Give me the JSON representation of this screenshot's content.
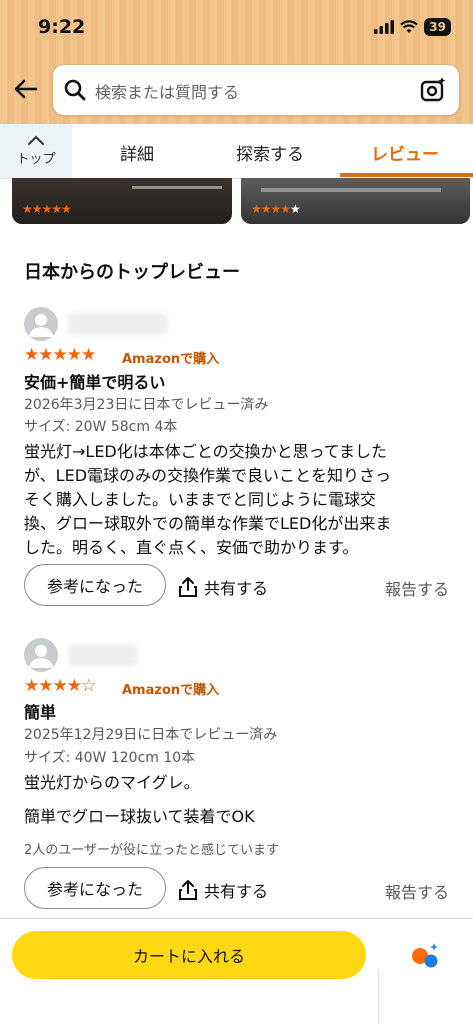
{
  "status": {
    "time": "9:22",
    "battery": "39"
  },
  "search": {
    "placeholder": "検索または質問する"
  },
  "tabs": {
    "top_label": "トップ",
    "items": [
      {
        "label": "詳細"
      },
      {
        "label": "探索する"
      },
      {
        "label": "レビュー"
      }
    ]
  },
  "section_title": "日本からのトップレビュー",
  "reviews": [
    {
      "rating": 5,
      "verified": "Amazonで購入",
      "title": "安価+簡単で明るい",
      "date": "2026年3月23日に日本でレビュー済み",
      "variant": "サイズ: 20W 58cm 4本",
      "body": [
        "蛍光灯→LED化は本体ごとの交換かと思ってました",
        "が、LED電球のみの交換作業で良いことを知りさっ",
        "そく購入しました。いままでと同じように電球交",
        "換、グロー球取外での簡単な作業でLED化が出来ま",
        "した。明るく、直ぐ点く、安価で助かります。"
      ],
      "helpful_label": "参考になった",
      "share_label": "共有する",
      "report_label": "報告する"
    },
    {
      "rating": 4,
      "verified": "Amazonで購入",
      "title": "簡単",
      "date": "2025年12月29日に日本でレビュー済み",
      "variant": "サイズ: 40W 120cm 10本",
      "body": [
        "蛍光灯からのマイグレ。",
        "簡単でグロー球抜いて装着でOK"
      ],
      "helpful_note": "2人のユーザーが役に立ったと感じています",
      "helpful_label": "参考になった",
      "share_label": "共有する",
      "report_label": "報告する"
    }
  ],
  "thumbnails": [
    {
      "rating": 5
    },
    {
      "rating": 4
    }
  ],
  "cart": {
    "label": "カートに入れる"
  },
  "colors": {
    "accent": "#e56a0a",
    "star": "#f1650f",
    "cart": "#ffd814",
    "header": "#f3c58d"
  }
}
